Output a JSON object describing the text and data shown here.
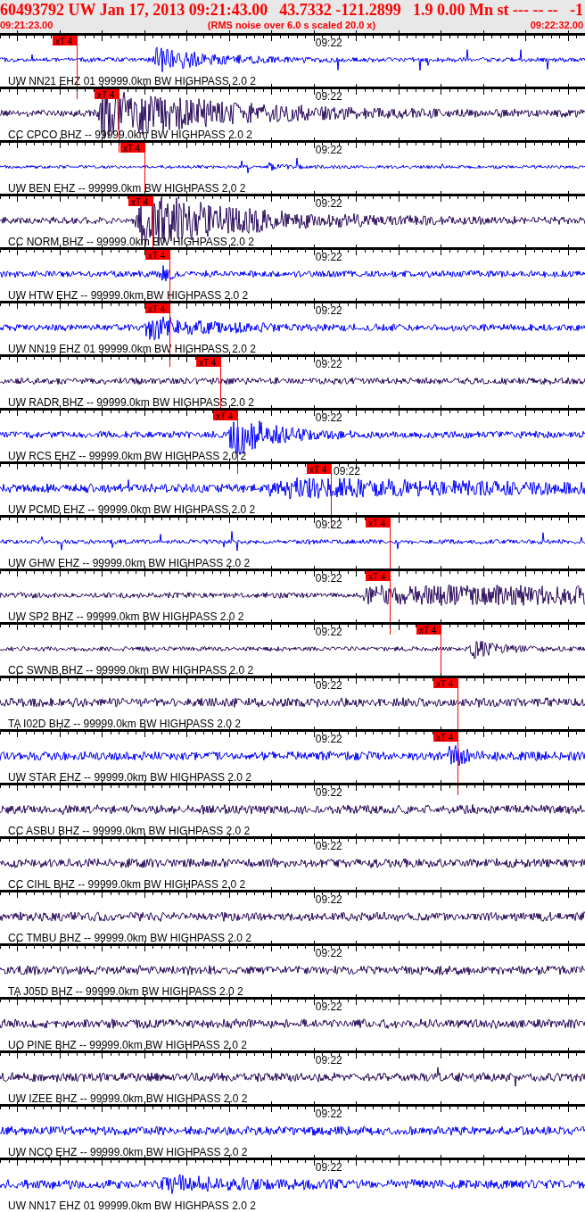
{
  "header": {
    "title_parts": [
      "60493792 UW Jan 17, 2013 09:21:43.00",
      "43.7332 -121.2899",
      "1.9 0.00 Mn st --- -- --",
      "-1"
    ],
    "start_time": "09:21:23.00",
    "caption": "(RMS noise over 6.0 s scaled 20.0 x)",
    "end_time": "09:22:32.00"
  },
  "traces": [
    {
      "label": "UW NN21 EHZ 01 99999.0km BW HIGHPASS 2.0 2",
      "time_label": "09:22",
      "color": "#0000ff",
      "pick": {
        "label": "xT 4",
        "level": 0.131
      }
    },
    {
      "label": "CC CPCO BHZ -- 99999.0km BW HIGHPASS 2.0 2",
      "time_label": "09:22",
      "color": "#2a0a5a",
      "pick": {
        "label": "xT 4",
        "level": 0.203
      }
    },
    {
      "label": "UW BEN EHZ -- 99999.0km BW HIGHPASS 2.0 2",
      "time_label": "09:22",
      "color": "#0000ff",
      "pick": {
        "label": "xT 4",
        "level": 0.247
      }
    },
    {
      "label": "CC NORM BHZ -- 99999.0km BW HIGHPASS 2.0 2",
      "time_label": "09:22",
      "color": "#2a0a5a",
      "pick": {
        "label": "xT 4",
        "level": 0.261
      }
    },
    {
      "label": "UW HTW EHZ -- 99999.0km BW HIGHPASS 2.0 2",
      "time_label": "09:22",
      "color": "#0000ff",
      "pick": {
        "label": "xT 4",
        "level": 0.29
      }
    },
    {
      "label": "UW NN19 EHZ 01 99999.0km BW HIGHPASS 2.0 2",
      "time_label": "09:22",
      "color": "#0000ff",
      "pick": {
        "label": "xT 4",
        "level": 0.29
      }
    },
    {
      "label": "UW RADR BHZ -- 99999.0km BW HIGHPASS 2.0 2",
      "time_label": "09:22",
      "color": "#2a0a5a",
      "pick": {
        "label": "xT 4",
        "level": 0.377
      }
    },
    {
      "label": "UW RCS EHZ -- 99999.0km BW HIGHPASS 2.0 2",
      "time_label": "09:22",
      "color": "#0000ff",
      "pick": {
        "label": "xT 4",
        "level": 0.405
      }
    },
    {
      "label": "UW PCMD EHZ -- 99999.0km BW HIGHPASS 2.0 2",
      "time_label": "09:22",
      "color": "#0000ff",
      "pick": {
        "label": "xT 4",
        "level": 0.566
      }
    },
    {
      "label": "UW GHW EHZ -- 99999.0km BW HIGHPASS 2.0 2",
      "time_label": "09:22",
      "color": "#0000ff",
      "pick": {
        "label": "xT 4",
        "level": 0.666
      }
    },
    {
      "label": "UW SP2 BHZ -- 99999.0km BW HIGHPASS 2.0 2",
      "time_label": "09:22",
      "color": "#2a0a5a",
      "pick": {
        "label": "xT 4",
        "level": 0.666
      }
    },
    {
      "label": "CC SWNB BHZ -- 99999.0km BW HIGHPASS 2.0 2",
      "time_label": "09:22",
      "color": "#2a0a5a",
      "pick": {
        "label": "xT 4",
        "level": 0.753
      }
    },
    {
      "label": "TA I02D BHZ -- 99999.0km BW HIGHPASS 2.0 2",
      "time_label": "09:22",
      "color": "#2a0a5a",
      "pick": {
        "label": "xT 4",
        "level": 0.782
      }
    },
    {
      "label": "UW STAR EHZ -- 99999.0km BW HIGHPASS 2.0 2",
      "time_label": "09:22",
      "color": "#0000ff",
      "pick": {
        "label": "xT 4",
        "level": 0.782
      }
    },
    {
      "label": "CC ASBU BHZ -- 99999.0km BW HIGHPASS 2.0 2",
      "time_label": "09:22",
      "color": "#2a0a5a"
    },
    {
      "label": "CC CIHL BHZ -- 99999.0km BW HIGHPASS 2.0 2",
      "time_label": "09:22",
      "color": "#2a0a5a"
    },
    {
      "label": "CC TMBU BHZ -- 99999.0km BW HIGHPASS 2.0 2",
      "time_label": "09:22",
      "color": "#2a0a5a"
    },
    {
      "label": "TA J05D BHZ -- 99999.0km BW HIGHPASS 2.0 2",
      "time_label": "09:22",
      "color": "#2a0a5a"
    },
    {
      "label": "UO PINE BHZ -- 99999.0km BW HIGHPASS 2.0 2",
      "time_label": "09:22",
      "color": "#2a0a5a"
    },
    {
      "label": "UW IZEE BHZ -- 99999.0km BW HIGHPASS 2.0 2",
      "time_label": "09:22",
      "color": "#2a0a5a"
    },
    {
      "label": "UW NCQ EHZ -- 99999.0km BW HIGHPASS 2.0 2",
      "time_label": "09:22",
      "color": "#0000ff"
    },
    {
      "label": "UW NN17 EHZ 01 99999.0km BW HIGHPASS 2.0 2",
      "time_label": "09:22",
      "color": "#0000ff"
    }
  ]
}
